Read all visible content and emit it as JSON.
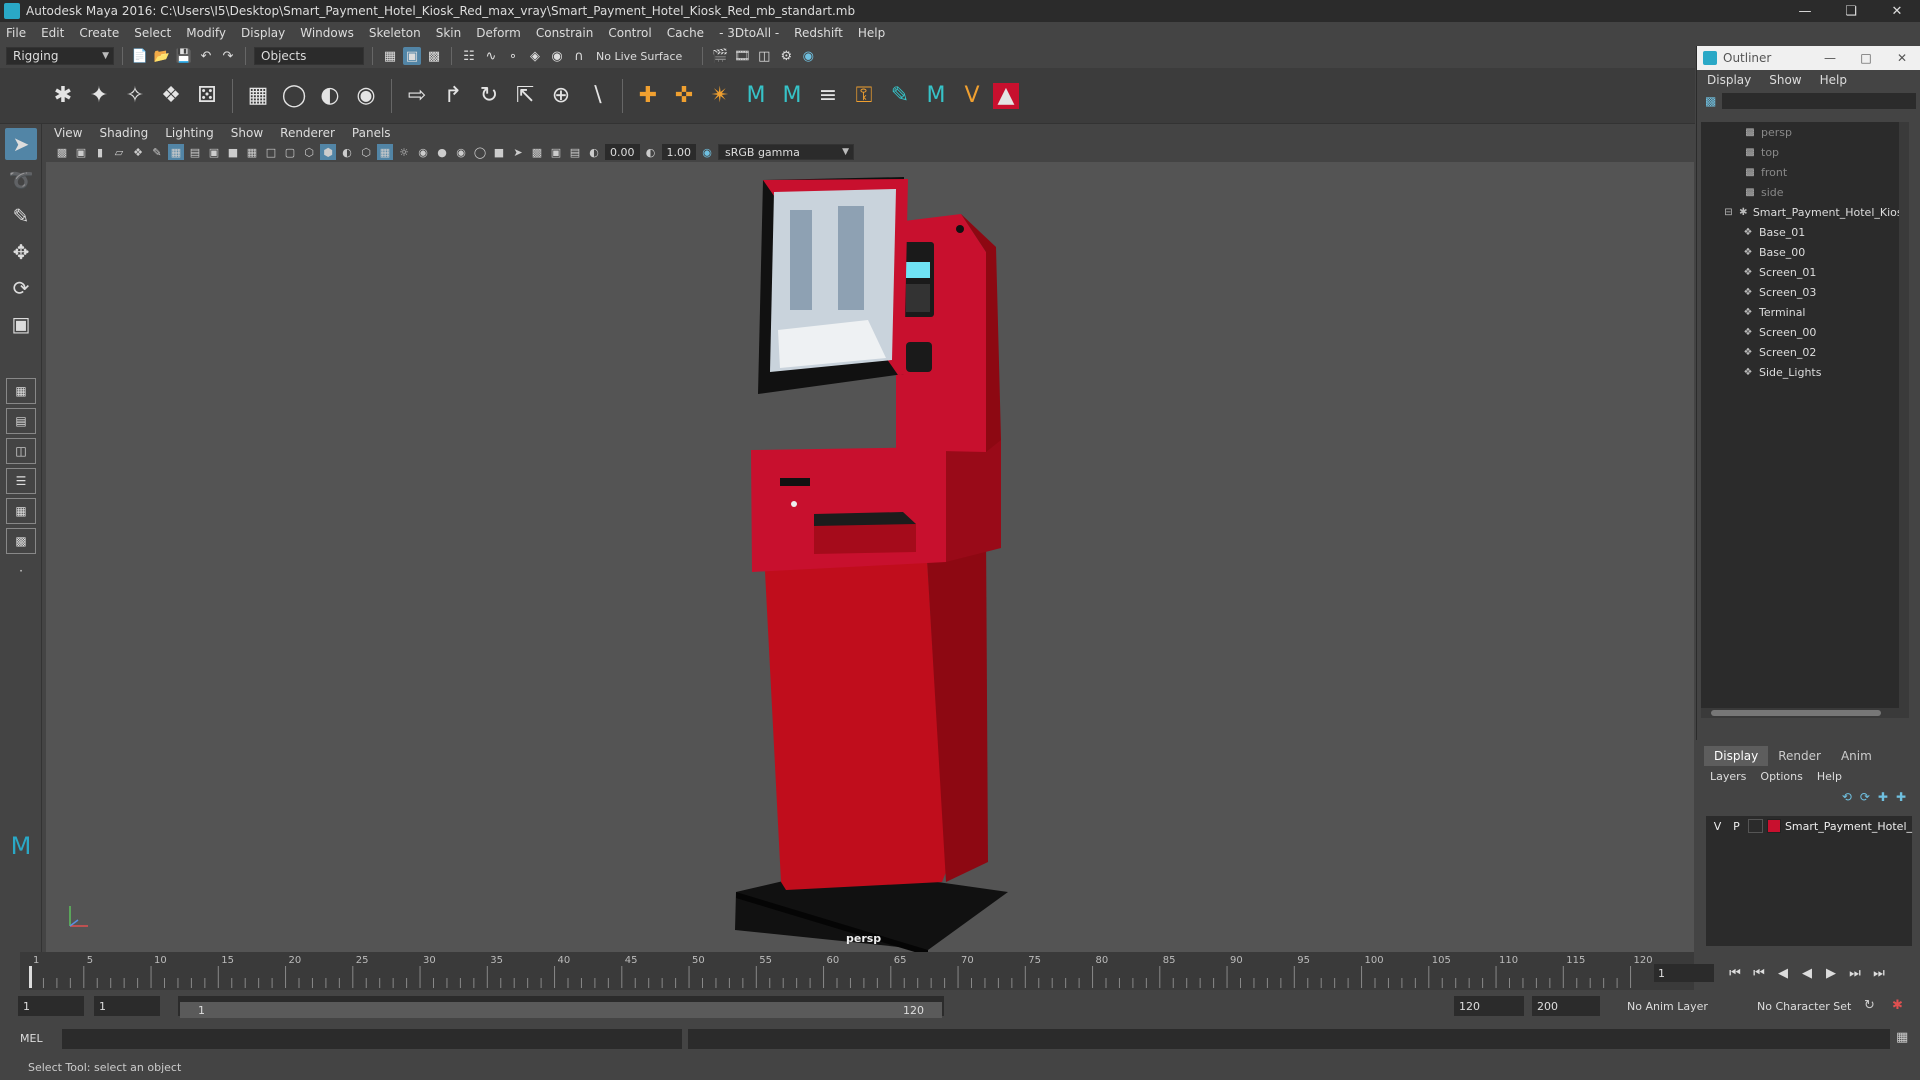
{
  "window": {
    "title": "Autodesk Maya 2016: C:\\Users\\I5\\Desktop\\Smart_Payment_Hotel_Kiosk_Red_max_vray\\Smart_Payment_Hotel_Kiosk_Red_mb_standart.mb"
  },
  "menubar": [
    "File",
    "Edit",
    "Create",
    "Select",
    "Modify",
    "Display",
    "Windows",
    "Skeleton",
    "Skin",
    "Deform",
    "Constrain",
    "Control",
    "Cache",
    "- 3DtoAll -",
    "Redshift",
    "Help"
  ],
  "statusline": {
    "menuset": "Rigging",
    "selection_mode": "Objects",
    "live_surface": "No Live Surface"
  },
  "viewport": {
    "menu": [
      "View",
      "Shading",
      "Lighting",
      "Show",
      "Renderer",
      "Panels"
    ],
    "exposure": "0.00",
    "gamma": "1.00",
    "color_space": "sRGB gamma",
    "camera": "persp"
  },
  "outliner": {
    "title": "Outliner",
    "menu": [
      "Display",
      "Show",
      "Help"
    ],
    "cameras": [
      "persp",
      "top",
      "front",
      "side"
    ],
    "root": "Smart_Payment_Hotel_Kiosk",
    "children": [
      "Base_01",
      "Base_00",
      "Screen_01",
      "Screen_03",
      "Terminal",
      "Screen_00",
      "Screen_02",
      "Side_Lights"
    ]
  },
  "layers": {
    "tabs": [
      "Display",
      "Render",
      "Anim"
    ],
    "menu": [
      "Layers",
      "Options",
      "Help"
    ],
    "layer": {
      "v": "V",
      "p": "P",
      "name": "Smart_Payment_Hotel_",
      "color": "#c8102e"
    }
  },
  "timeline": {
    "ticks": [
      "1",
      "5",
      "10",
      "15",
      "20",
      "25",
      "30",
      "35",
      "40",
      "45",
      "50",
      "55",
      "60",
      "65",
      "70",
      "75",
      "80",
      "85",
      "90",
      "95",
      "100",
      "105",
      "110",
      "115",
      "120"
    ],
    "current_frame": "1"
  },
  "range": {
    "start": "1",
    "playback_start": "1",
    "slider_start": "1",
    "slider_end": "120",
    "playback_end": "120",
    "end": "200",
    "anim_layer": "No Anim Layer",
    "character_set": "No Character Set"
  },
  "cmdline": {
    "label": "MEL"
  },
  "helpline": "Select Tool: select an object",
  "colors": {
    "accent": "#5285a6",
    "kiosk_red": "#c8102e",
    "maya_teal": "#2aa8c6"
  }
}
